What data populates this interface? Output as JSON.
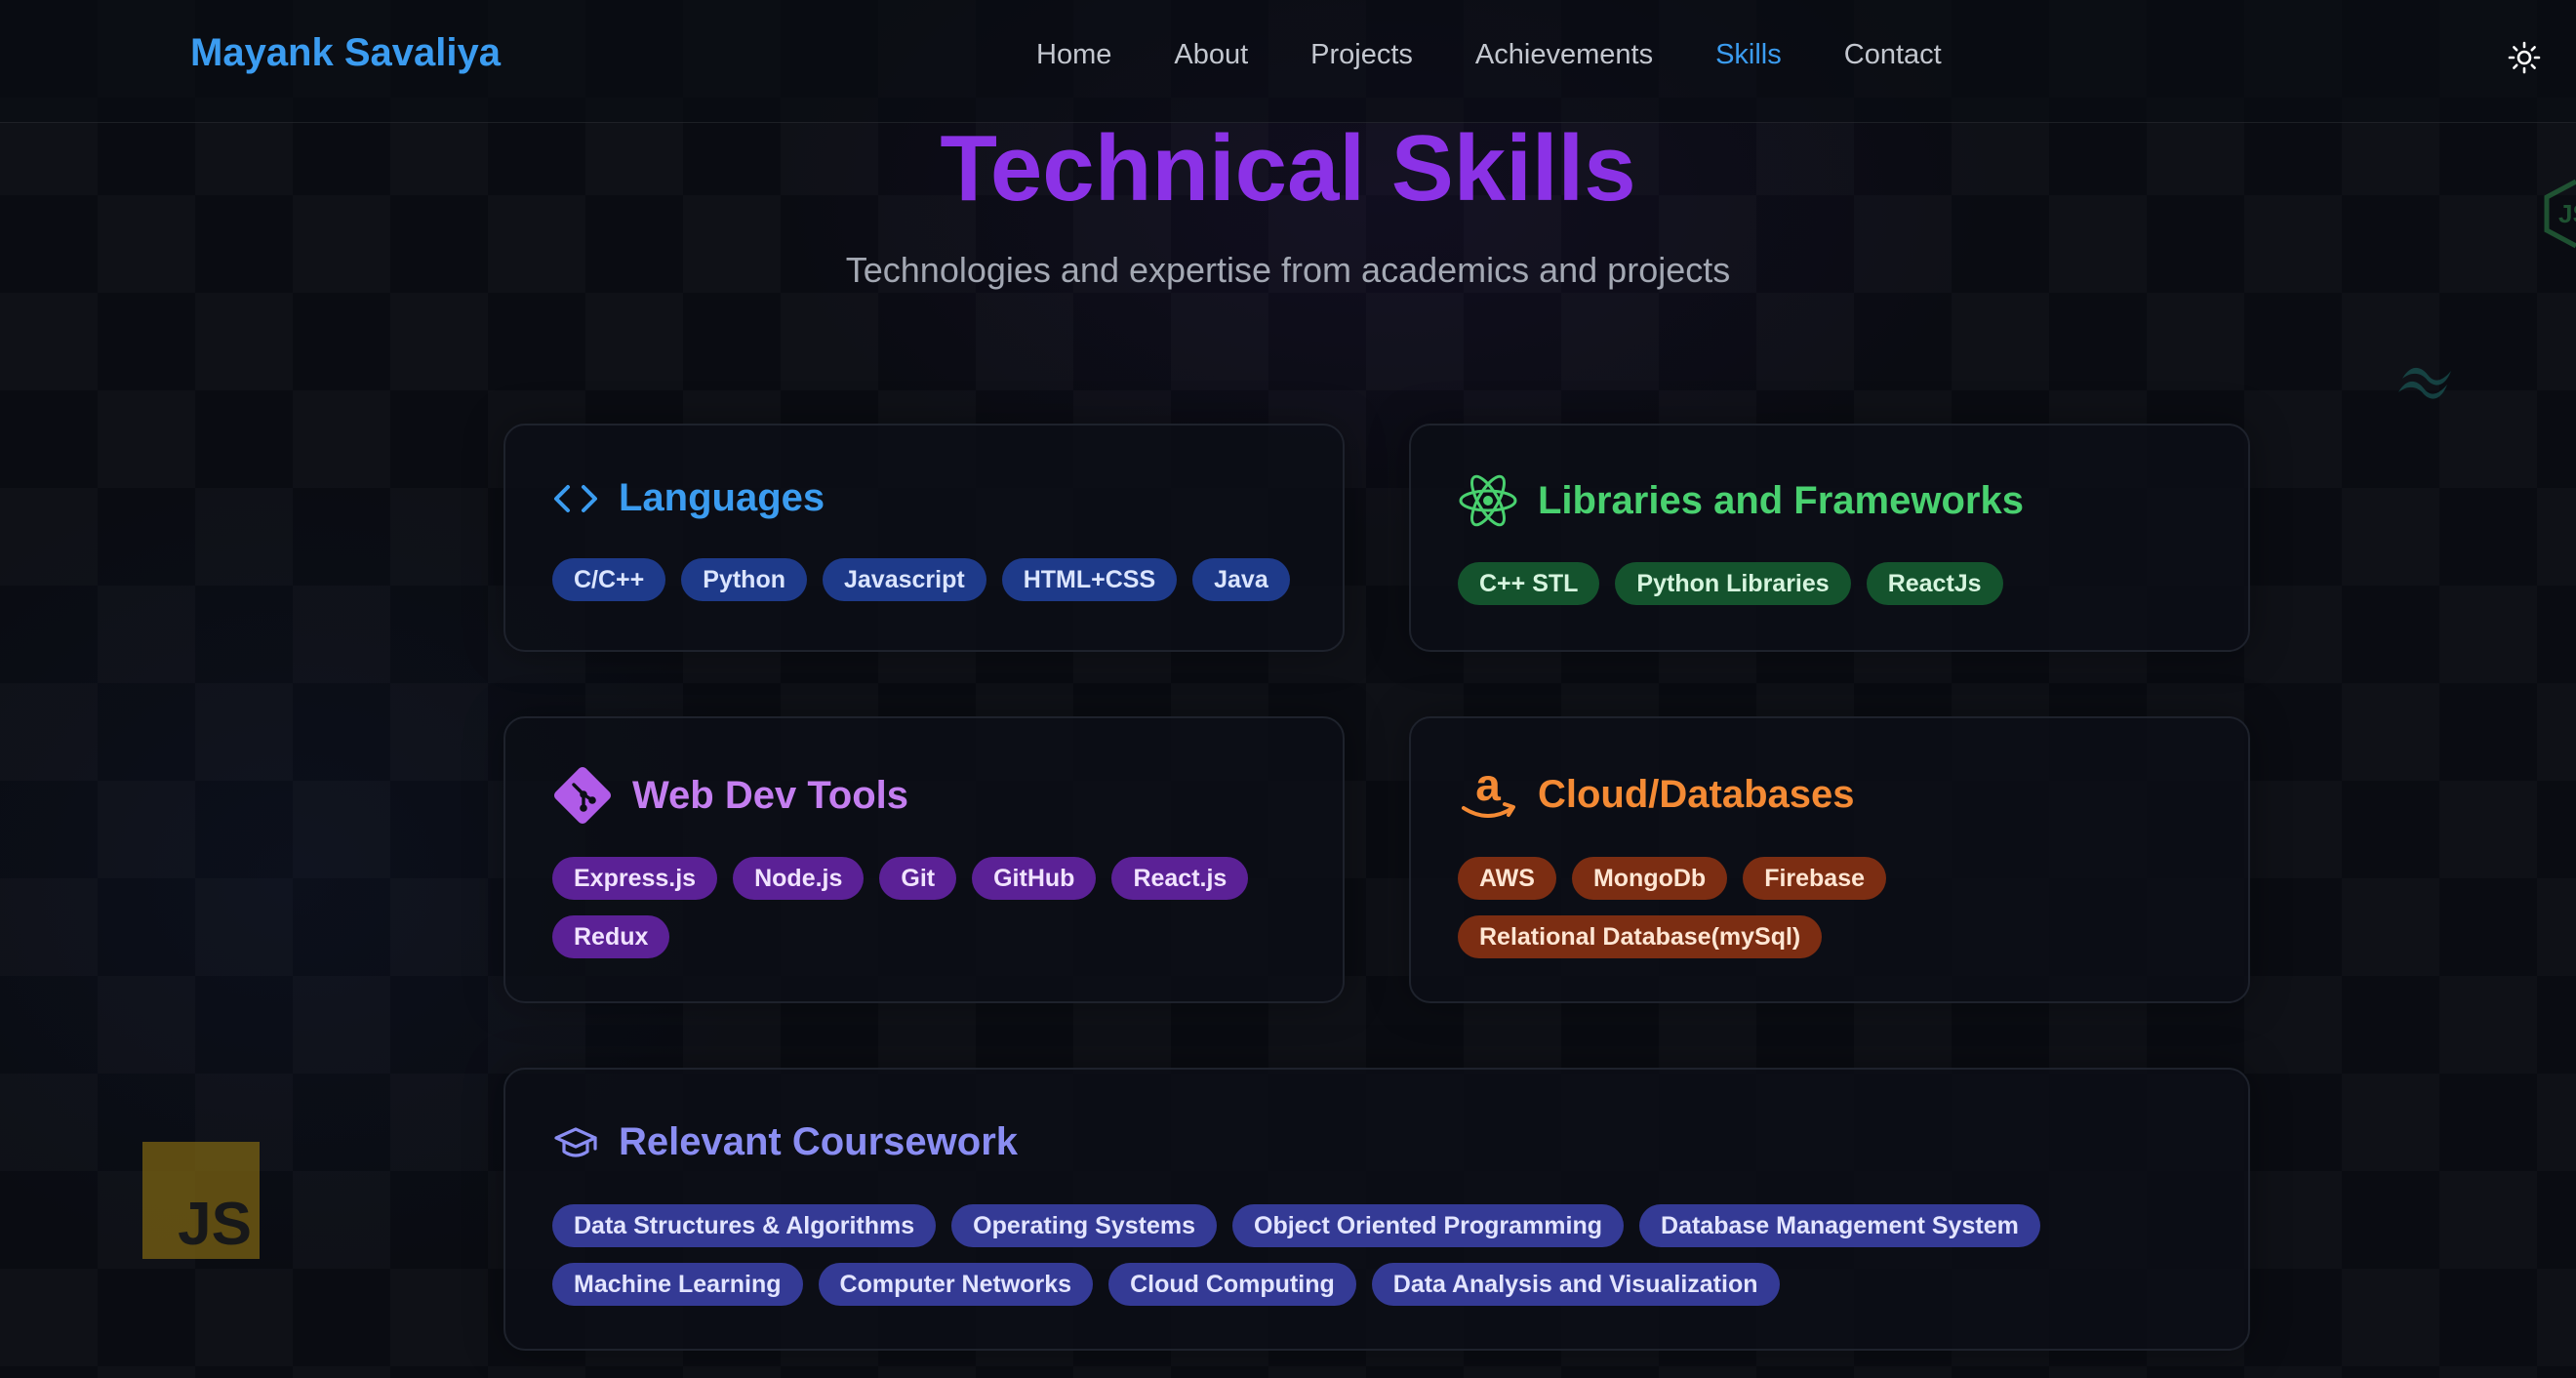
{
  "brand": "Mayank Savaliya",
  "nav": {
    "items": [
      "Home",
      "About",
      "Projects",
      "Achievements",
      "Skills",
      "Contact"
    ],
    "active": "Skills"
  },
  "theme_toggle_icon": "sun-icon",
  "section": {
    "title": "Technical Skills",
    "subtitle": "Technologies and expertise from academics and projects"
  },
  "cards": {
    "languages": {
      "icon": "code-icon",
      "title": "Languages",
      "tags": [
        "C/C++",
        "Python",
        "Javascript",
        "HTML+CSS",
        "Java"
      ]
    },
    "libraries": {
      "icon": "react-icon",
      "title": "Libraries and Frameworks",
      "tags": [
        "C++ STL",
        "Python Libraries",
        "ReactJs"
      ]
    },
    "webdev": {
      "icon": "git-icon",
      "title": "Web Dev Tools",
      "tags": [
        "Express.js",
        "Node.js",
        "Git",
        "GitHub",
        "React.js",
        "Redux"
      ]
    },
    "cloud": {
      "icon": "amazon-icon",
      "title": "Cloud/Databases",
      "tags": [
        "AWS",
        "MongoDb",
        "Firebase",
        "Relational Database(mySql)"
      ]
    },
    "coursework": {
      "icon": "graduation-cap-icon",
      "title": "Relevant Coursework",
      "tags": [
        "Data Structures & Algorithms",
        "Operating Systems",
        "Object Oriented Programming",
        "Database Management System",
        "Machine Learning",
        "Computer Networks",
        "Cloud Computing",
        "Data Analysis and Visualization"
      ]
    }
  },
  "decorations": {
    "js_badge": "JS"
  },
  "colors": {
    "brand": "#3b9cf0",
    "title": "#8b32e6",
    "languages": "#3b9cf0",
    "libraries": "#49d16f",
    "webdev": "#c47ef0",
    "cloud": "#f48a34",
    "coursework": "#8a8df2"
  }
}
